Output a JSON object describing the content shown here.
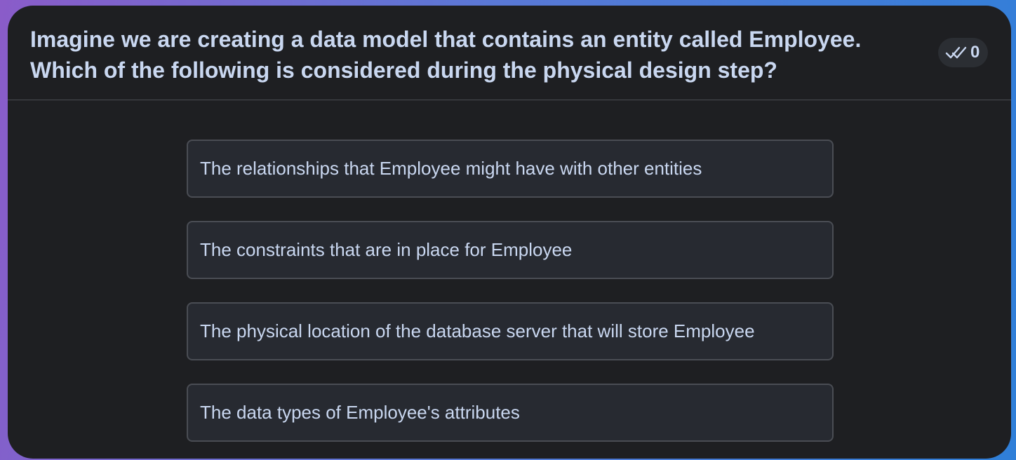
{
  "question": {
    "text": "Imagine we are creating a data model that contains an entity called Employee. Which of the following is considered during the physical design step?"
  },
  "votes": {
    "icon": "double-check-icon",
    "count": "0"
  },
  "options": [
    {
      "label": "The relationships that Employee might have with other entities"
    },
    {
      "label": "The constraints that are in place for Employee"
    },
    {
      "label": "The physical location of the database server that will store Employee"
    },
    {
      "label": "The data types of Employee's attributes"
    }
  ],
  "colors": {
    "card_background": "#1e1f22",
    "option_background": "#272a31",
    "option_border": "#4a4d54",
    "text": "#c9d7f0",
    "gradient_left": "#8a5cc9",
    "gradient_right": "#2f7fd8"
  }
}
